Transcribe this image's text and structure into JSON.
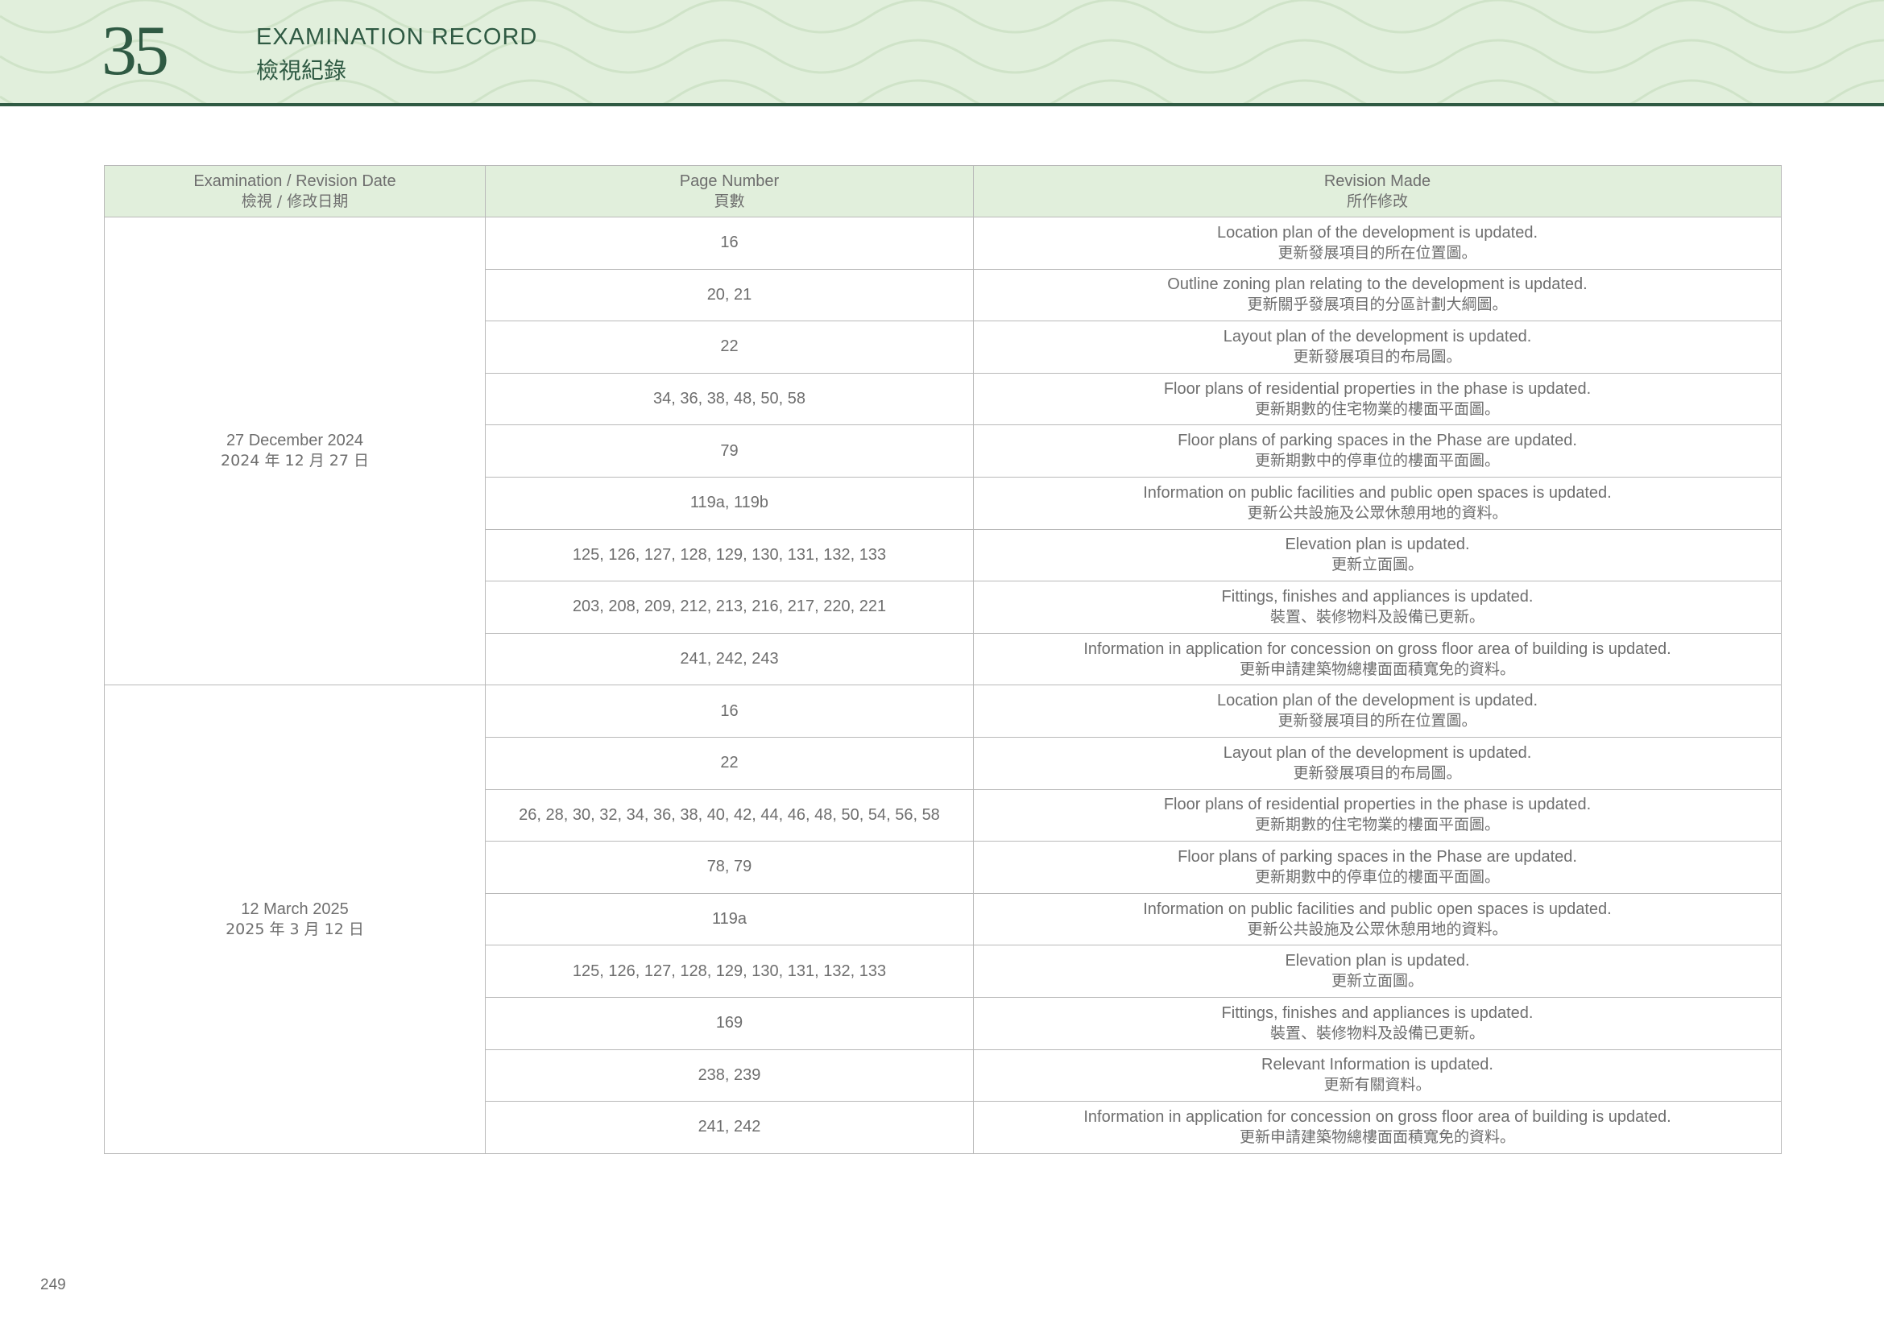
{
  "header": {
    "section_number": "35",
    "title_en": "EXAMINATION RECORD",
    "title_zh": "檢視紀錄"
  },
  "table": {
    "columns": [
      {
        "en": "Examination / Revision Date",
        "zh": "檢視 / 修改日期"
      },
      {
        "en": "Page Number",
        "zh": "頁數"
      },
      {
        "en": "Revision Made",
        "zh": "所作修改"
      }
    ],
    "groups": [
      {
        "date_en": "27 December 2024",
        "date_zh": "2024 年 12 月 27 日",
        "rows": [
          {
            "pages": "16",
            "rev_en": "Location plan of the development is updated.",
            "rev_zh": "更新發展項目的所在位置圖。"
          },
          {
            "pages": "20, 21",
            "rev_en": "Outline zoning plan relating to the development is updated.",
            "rev_zh": "更新關乎發展項目的分區計劃大綱圖。"
          },
          {
            "pages": "22",
            "rev_en": "Layout plan of the development is updated.",
            "rev_zh": "更新發展項目的布局圖。"
          },
          {
            "pages": "34, 36, 38, 48, 50, 58",
            "rev_en": "Floor plans of residential properties in the phase is updated.",
            "rev_zh": "更新期數的住宅物業的樓面平面圖。"
          },
          {
            "pages": "79",
            "rev_en": "Floor plans of parking spaces in the Phase are updated.",
            "rev_zh": "更新期數中的停車位的樓面平面圖。"
          },
          {
            "pages": "119a, 119b",
            "rev_en": "Information on public facilities and public open spaces is updated.",
            "rev_zh": "更新公共設施及公眾休憩用地的資料。"
          },
          {
            "pages": "125, 126, 127, 128, 129, 130, 131, 132, 133",
            "rev_en": "Elevation plan is updated.",
            "rev_zh": "更新立面圖。"
          },
          {
            "pages": "203, 208, 209, 212, 213, 216, 217, 220, 221",
            "rev_en": "Fittings, finishes and appliances is updated.",
            "rev_zh": "裝置、裝修物料及設備已更新。"
          },
          {
            "pages": "241, 242, 243",
            "rev_en": "Information in application for concession on gross floor area of building is updated.",
            "rev_zh": "更新申請建築物總樓面面積寬免的資料。"
          }
        ]
      },
      {
        "date_en": "12 March 2025",
        "date_zh": "2025 年 3 月 12 日",
        "rows": [
          {
            "pages": "16",
            "rev_en": "Location plan of the development is updated.",
            "rev_zh": "更新發展項目的所在位置圖。"
          },
          {
            "pages": "22",
            "rev_en": "Layout plan of the development is updated.",
            "rev_zh": "更新發展項目的布局圖。"
          },
          {
            "pages": "26, 28, 30, 32, 34, 36, 38, 40, 42, 44, 46, 48, 50, 54, 56, 58",
            "rev_en": "Floor plans of residential properties in the phase is updated.",
            "rev_zh": "更新期數的住宅物業的樓面平面圖。"
          },
          {
            "pages": "78, 79",
            "rev_en": "Floor plans of parking spaces in the Phase are updated.",
            "rev_zh": "更新期數中的停車位的樓面平面圖。"
          },
          {
            "pages": "119a",
            "rev_en": "Information on public facilities and public open spaces is updated.",
            "rev_zh": "更新公共設施及公眾休憩用地的資料。"
          },
          {
            "pages": "125, 126, 127, 128, 129, 130, 131, 132, 133",
            "rev_en": "Elevation plan is updated.",
            "rev_zh": "更新立面圖。"
          },
          {
            "pages": "169",
            "rev_en": "Fittings, finishes and appliances is updated.",
            "rev_zh": "裝置、裝修物料及設備已更新。"
          },
          {
            "pages": "238, 239",
            "rev_en": "Relevant Information is updated.",
            "rev_zh": "更新有關資料。"
          },
          {
            "pages": "241, 242",
            "rev_en": "Information in application for concession on gross floor area of building is updated.",
            "rev_zh": "更新申請建築物總樓面面積寬免的資料。"
          }
        ]
      }
    ]
  },
  "footer": {
    "page_number": "249"
  },
  "colors": {
    "accent": "#2f5a43",
    "header_bg": "#e1efdc",
    "text": "#6e6e6e",
    "border": "#b9b9b9"
  }
}
